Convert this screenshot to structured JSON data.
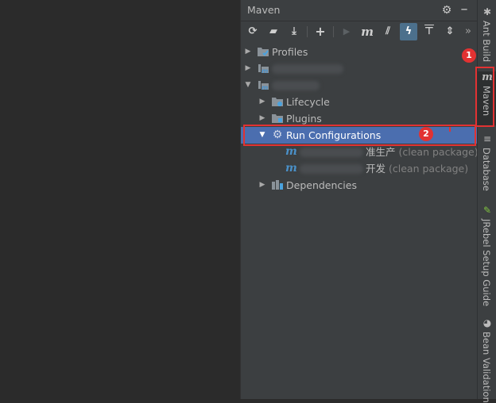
{
  "panel": {
    "title": "Maven",
    "settings_icon": "gear-icon",
    "more_icon": "chevrons-right-icon",
    "more_label": "»"
  },
  "toolbar": {
    "buttons": [
      {
        "name": "reload",
        "icon": "refresh-icon",
        "glyph": "⟳"
      },
      {
        "name": "generate-sources",
        "icon": "folder-refresh-icon",
        "glyph": "▰"
      },
      {
        "name": "download",
        "icon": "download-icon",
        "glyph": "⤓"
      },
      {
        "name": "add",
        "icon": "plus-icon",
        "glyph": "+"
      },
      {
        "name": "run",
        "icon": "play-icon",
        "glyph": "▶"
      },
      {
        "name": "execute-goal",
        "icon": "maven-m-icon",
        "glyph": "m"
      },
      {
        "name": "toggle-offline",
        "icon": "offline-icon",
        "glyph": "⫽"
      },
      {
        "name": "skip-tests",
        "icon": "lightning-icon",
        "glyph": "ϟ"
      },
      {
        "name": "show-dependencies",
        "icon": "diagram-icon",
        "glyph": "⊤"
      },
      {
        "name": "collapse-all",
        "icon": "collapse-icon",
        "glyph": "⇕"
      }
    ]
  },
  "tree": {
    "profiles": "Profiles",
    "lifecycle": "Lifecycle",
    "plugins": "Plugins",
    "run_configurations": "Run Configurations",
    "config1_suffix": "准生产",
    "config1_hint": "(clean package)",
    "config2_suffix": "开发",
    "config2_hint": "(clean package)",
    "dependencies": "Dependencies"
  },
  "right_strip": {
    "tabs": [
      {
        "label": "Ant Build",
        "icon": "ant-icon"
      },
      {
        "label": "Maven",
        "icon": "maven-m-icon"
      },
      {
        "label": "Database",
        "icon": "database-icon"
      },
      {
        "label": "JRebel Setup Guide",
        "icon": "jrebel-icon"
      },
      {
        "label": "Bean Validation",
        "icon": "bean-icon"
      }
    ]
  },
  "annotations": {
    "badge1": "1",
    "badge2": "2"
  },
  "colors": {
    "selection": "#4b6eaf",
    "annotation_red": "#e23232",
    "maven_blue": "#4a90c8"
  }
}
